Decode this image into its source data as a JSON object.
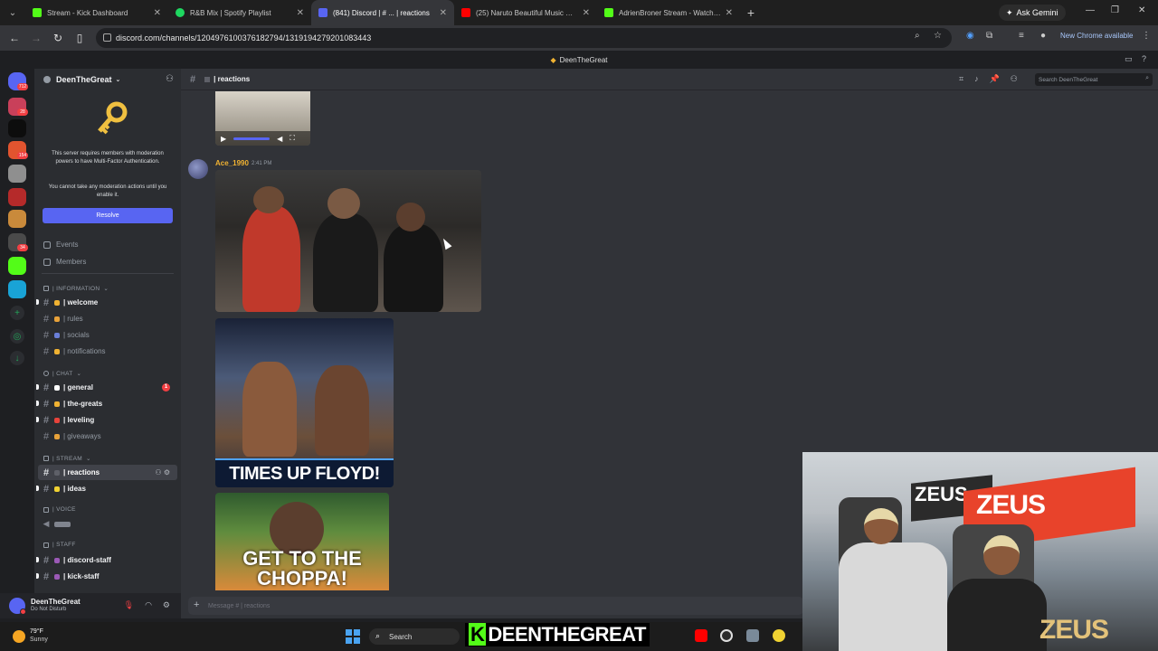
{
  "browser": {
    "tabs": [
      {
        "label": "Stream - Kick Dashboard",
        "color": "#53fc18"
      },
      {
        "label": "R&B Mix | Spotify Playlist",
        "color": "#1ed760"
      },
      {
        "label": "(841) Discord | # ... | reactions",
        "color": "#5865f2"
      },
      {
        "label": "(25) Naruto Beautiful Music Mi...",
        "color": "#ff0000"
      },
      {
        "label": "AdrienBroner Stream - Watch L...",
        "color": "#53fc18"
      }
    ],
    "ask_gemini": "Ask Gemini",
    "url": "discord.com/channels/1204976100376182794/1319194279201083443",
    "new_chrome": "New Chrome available"
  },
  "discord": {
    "window_title": "DeenTheGreat",
    "server_name": "DeenTheGreat",
    "mfa_message": "This server requires members with moderation powers to have Multi-Factor Authentication.",
    "mfa_sub": "You cannot take any moderation actions until you enable it.",
    "resolve_label": "Resolve",
    "events_label": "Events",
    "members_label": "Members",
    "categories": {
      "information": "| INFORMATION",
      "chat": "| CHAT",
      "stream": "| STREAM",
      "voice": "| VOICE",
      "staff": "| STAFF"
    },
    "channels": {
      "welcome": "| welcome",
      "rules": "| rules",
      "socials": "| socials",
      "notifications": "| notifications",
      "general": "| general",
      "general_mentions": "1",
      "the_greats": "| the-greats",
      "leveling": "| leveling",
      "giveaways": "| giveaways",
      "reactions": "| reactions",
      "ideas": "| ideas",
      "discord_staff": "| discord-staff",
      "kick_staff": "| kick-staff"
    },
    "server_badges": [
      "712",
      "28",
      "154",
      "34"
    ],
    "user": {
      "name": "DeenTheGreat",
      "status": "Do Not Disturb"
    },
    "chat_header": "| reactions",
    "search_placeholder": "Search DeenTheGreat",
    "message": {
      "author": "Ace_1990",
      "time": "2:41 PM"
    },
    "image2_caption": "TIMES UP FLOYD!",
    "image3_caption": "GET TO THE CHOPPA!",
    "composer_placeholder": "Message # | reactions"
  },
  "webcam": {
    "banner_text": "ZEUS",
    "banner_text_2": "ZEUS",
    "logo_text": "ZEUS"
  },
  "taskbar": {
    "temperature": "79°F",
    "weather": "Sunny",
    "search_label": "Search",
    "streamer_k": "K",
    "streamer_name": "DEENTHEGREAT"
  }
}
